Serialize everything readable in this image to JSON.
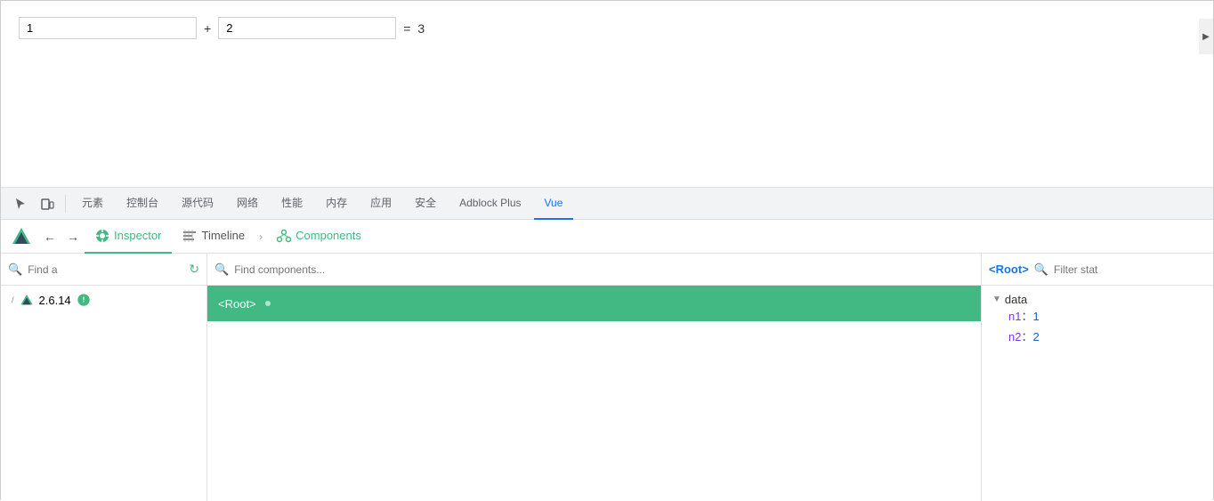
{
  "app": {
    "input1_value": "1",
    "input2_value": "2",
    "operator": "+",
    "equals": "=",
    "result": "3"
  },
  "devtools": {
    "tabs": [
      {
        "label": "元素",
        "active": false
      },
      {
        "label": "控制台",
        "active": false
      },
      {
        "label": "源代码",
        "active": false
      },
      {
        "label": "网络",
        "active": false
      },
      {
        "label": "性能",
        "active": false
      },
      {
        "label": "内存",
        "active": false
      },
      {
        "label": "应用",
        "active": false
      },
      {
        "label": "安全",
        "active": false
      },
      {
        "label": "Adblock Plus",
        "active": false
      },
      {
        "label": "Vue",
        "active": true
      }
    ]
  },
  "vue": {
    "tabs": [
      {
        "id": "inspector",
        "label": "Inspector",
        "active": true
      },
      {
        "id": "timeline",
        "label": "Timeline",
        "active": false
      },
      {
        "id": "components",
        "label": "Components",
        "active": false
      }
    ],
    "left_panel": {
      "search_placeholder": "Find a",
      "version": "2.6.14"
    },
    "middle_panel": {
      "search_placeholder": "Find components...",
      "root_component": "<Root>"
    },
    "right_panel": {
      "root_tag": "<Root>",
      "filter_placeholder": "Filter stat",
      "data_section": {
        "label": "data",
        "items": [
          {
            "key": "n1",
            "value": "1"
          },
          {
            "key": "n2",
            "value": "2"
          }
        ]
      }
    }
  }
}
